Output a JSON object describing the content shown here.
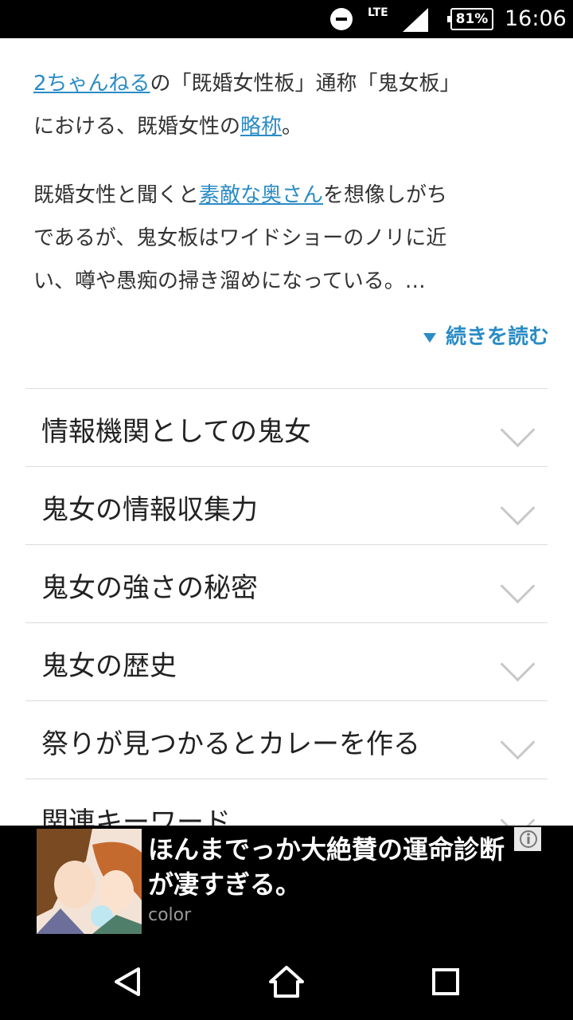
{
  "status_bar": {
    "network": "LTE",
    "battery": "81%",
    "time": "16:06"
  },
  "article": {
    "p1": {
      "link1": "2ちゃんねる",
      "t1": "の「既婚女性板」通称「鬼女板」",
      "t2": "における、既婚女性の",
      "link2": "略称",
      "t3": "。"
    },
    "p2": {
      "t1": "既婚女性と聞くと",
      "link1": "素敵な奥さん",
      "t2": "を想像しがち",
      "t3": "であるが、鬼女板はワイドショーのノリに近",
      "t4": "い、噂や愚痴の掃き溜めになっている。…"
    },
    "read_more": "続きを読む"
  },
  "accordion": [
    {
      "label": "情報機関としての鬼女"
    },
    {
      "label": "鬼女の情報収集力"
    },
    {
      "label": "鬼女の強さの秘密"
    },
    {
      "label": "鬼女の歴史"
    },
    {
      "label": "祭りが見つかるとカレーを作る"
    },
    {
      "label": "関連キーワード"
    }
  ],
  "ad": {
    "headline": "ほんまでっか大絶賛の運命診断が凄すぎる。",
    "source": "color"
  },
  "icons": {
    "dnd": "do-not-disturb-icon",
    "signal": "signal-icon",
    "battery": "battery-icon",
    "ad_info": "ad-choices-icon",
    "back": "back-icon",
    "home": "home-icon",
    "recents": "recents-icon",
    "chevron": "chevron-down-icon"
  }
}
